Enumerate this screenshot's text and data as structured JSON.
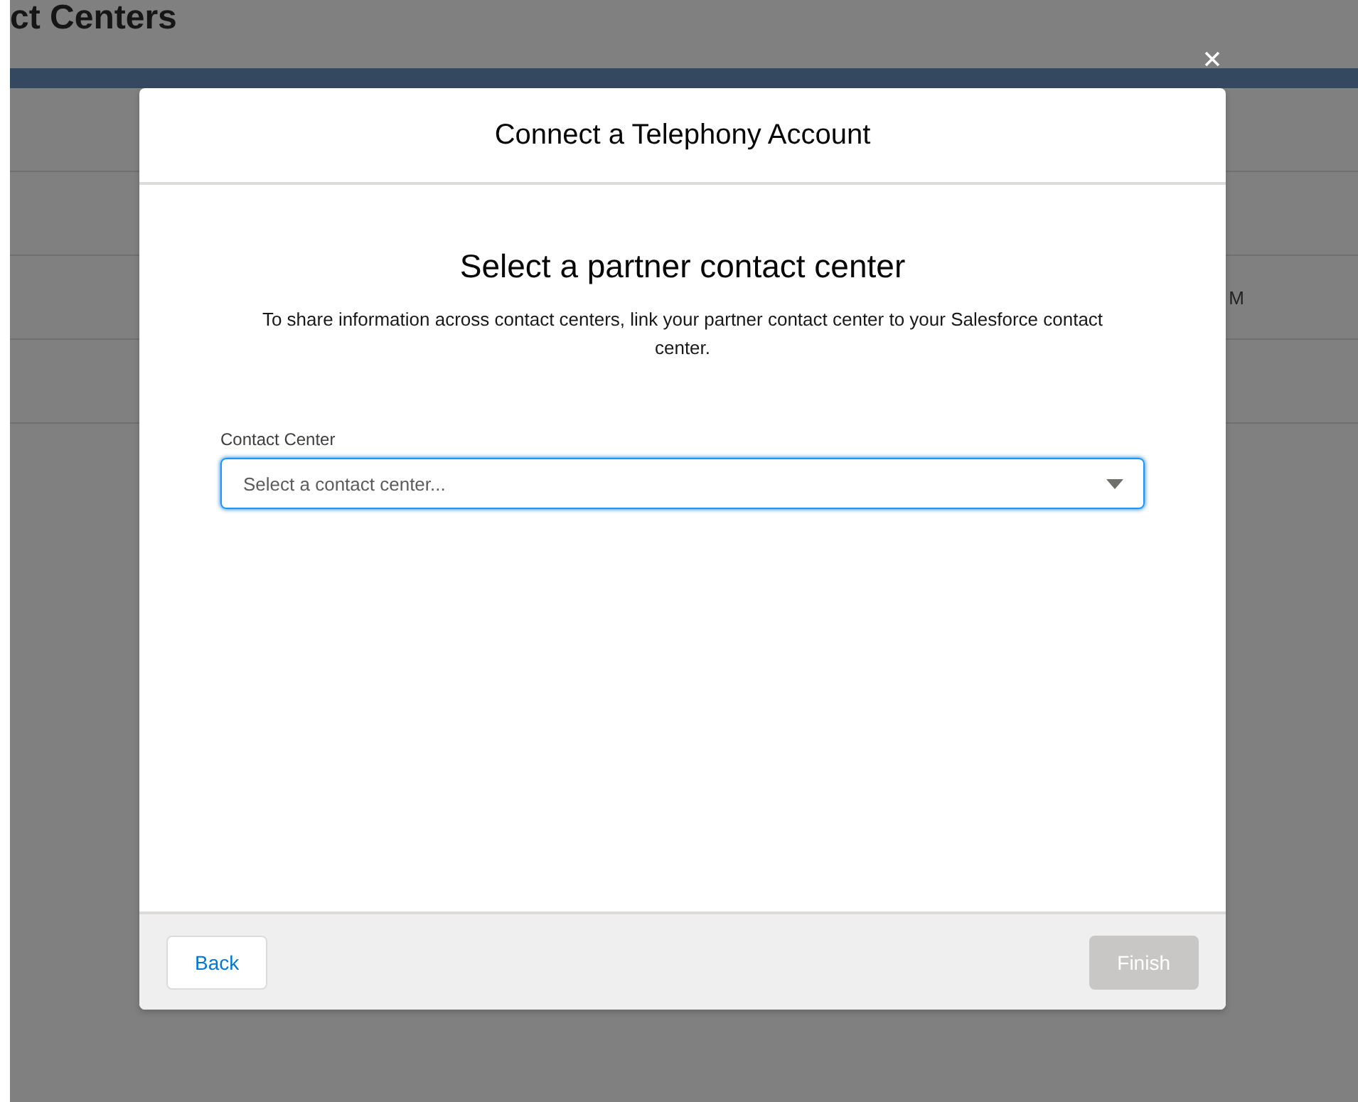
{
  "background_page": {
    "title": "ct Centers",
    "table_cell": "M"
  },
  "modal": {
    "title": "Connect a Telephony Account",
    "heading": "Select a partner contact center",
    "description": "To share information across contact centers, link your partner contact center to your Salesforce contact center.",
    "field": {
      "label": "Contact Center",
      "placeholder": "Select a contact center...",
      "focused": true
    },
    "buttons": [
      {
        "label": "Back",
        "disabled": false,
        "kind": "neutral"
      },
      {
        "label": "Finish",
        "disabled": true,
        "kind": "brand"
      }
    ]
  }
}
